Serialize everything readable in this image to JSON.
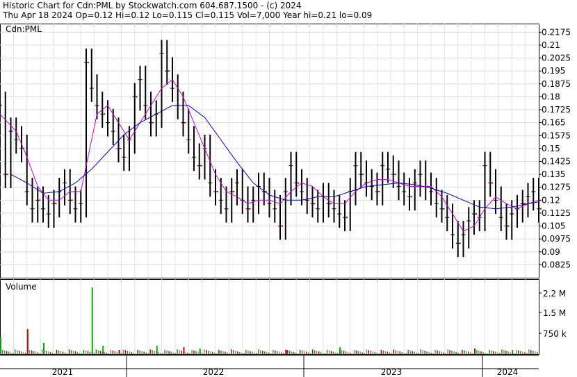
{
  "header": {
    "line1": "Historic Chart for Cdn:PML by Stockwatch.com 604.687.1500 - (c) 2024",
    "line2": "Thu Apr 18 2024  Op=0.12  Hi=0.12  Lo=0.115  Cl=0.115  Vol=7,000  Year hi=0.21  lo=0.09"
  },
  "chart_data": [
    {
      "type": "line",
      "title": "Cdn:PML",
      "y_ticks": [
        0.2175,
        0.21,
        0.2025,
        0.195,
        0.1875,
        0.18,
        0.1725,
        0.165,
        0.1575,
        0.15,
        0.1425,
        0.135,
        0.1275,
        0.12,
        0.1125,
        0.105,
        0.0975,
        0.09,
        0.0825
      ],
      "y_tick_labels": [
        "0.2175",
        "0.21",
        "0.2025",
        "0.195",
        "0.1875",
        "0.18",
        "0.1725",
        "0.165",
        "0.1575",
        "0.15",
        "0.1425",
        "0.135",
        "0.1275",
        "0.12",
        "0.1125",
        "0.105",
        "0.0975",
        "0.09",
        "0.0825"
      ],
      "ylim": [
        0.075,
        0.2225
      ],
      "x_labels": [
        "2021",
        "2022",
        "2023",
        "2024"
      ],
      "grid": true,
      "series_colors": {
        "price": "#000000",
        "short_ma": "#cc00cc",
        "long_ma": "#0000cc",
        "marks": "#dd0000"
      },
      "price_points": [
        [
          0.0,
          0.175
        ],
        [
          0.01,
          0.135
        ],
        [
          0.02,
          0.16
        ],
        [
          0.03,
          0.155
        ],
        [
          0.04,
          0.15
        ],
        [
          0.05,
          0.125
        ],
        [
          0.06,
          0.115
        ],
        [
          0.07,
          0.12
        ],
        [
          0.08,
          0.115
        ],
        [
          0.09,
          0.112
        ],
        [
          0.1,
          0.118
        ],
        [
          0.11,
          0.125
        ],
        [
          0.12,
          0.13
        ],
        [
          0.13,
          0.12
        ],
        [
          0.14,
          0.115
        ],
        [
          0.15,
          0.118
        ],
        [
          0.16,
          0.2
        ],
        [
          0.17,
          0.185
        ],
        [
          0.18,
          0.175
        ],
        [
          0.19,
          0.17
        ],
        [
          0.2,
          0.165
        ],
        [
          0.21,
          0.16
        ],
        [
          0.22,
          0.15
        ],
        [
          0.23,
          0.145
        ],
        [
          0.24,
          0.155
        ],
        [
          0.25,
          0.18
        ],
        [
          0.26,
          0.19
        ],
        [
          0.27,
          0.175
        ],
        [
          0.28,
          0.165
        ],
        [
          0.29,
          0.17
        ],
        [
          0.3,
          0.205
        ],
        [
          0.31,
          0.195
        ],
        [
          0.32,
          0.185
        ],
        [
          0.33,
          0.175
        ],
        [
          0.34,
          0.165
        ],
        [
          0.35,
          0.155
        ],
        [
          0.36,
          0.145
        ],
        [
          0.37,
          0.14
        ],
        [
          0.38,
          0.15
        ],
        [
          0.39,
          0.13
        ],
        [
          0.4,
          0.125
        ],
        [
          0.41,
          0.12
        ],
        [
          0.42,
          0.115
        ],
        [
          0.43,
          0.125
        ],
        [
          0.44,
          0.13
        ],
        [
          0.45,
          0.12
        ],
        [
          0.46,
          0.115
        ],
        [
          0.47,
          0.12
        ],
        [
          0.48,
          0.128
        ],
        [
          0.49,
          0.125
        ],
        [
          0.5,
          0.118
        ],
        [
          0.51,
          0.115
        ],
        [
          0.52,
          0.105
        ],
        [
          0.53,
          0.125
        ],
        [
          0.54,
          0.14
        ],
        [
          0.55,
          0.13
        ],
        [
          0.56,
          0.125
        ],
        [
          0.57,
          0.12
        ],
        [
          0.58,
          0.118
        ],
        [
          0.59,
          0.115
        ],
        [
          0.6,
          0.122
        ],
        [
          0.61,
          0.118
        ],
        [
          0.62,
          0.115
        ],
        [
          0.63,
          0.112
        ],
        [
          0.64,
          0.11
        ],
        [
          0.65,
          0.125
        ],
        [
          0.66,
          0.14
        ],
        [
          0.67,
          0.135
        ],
        [
          0.68,
          0.13
        ],
        [
          0.69,
          0.128
        ],
        [
          0.7,
          0.125
        ],
        [
          0.71,
          0.14
        ],
        [
          0.72,
          0.138
        ],
        [
          0.73,
          0.135
        ],
        [
          0.74,
          0.128
        ],
        [
          0.75,
          0.125
        ],
        [
          0.76,
          0.122
        ],
        [
          0.77,
          0.13
        ],
        [
          0.78,
          0.135
        ],
        [
          0.79,
          0.128
        ],
        [
          0.8,
          0.125
        ],
        [
          0.81,
          0.118
        ],
        [
          0.82,
          0.115
        ],
        [
          0.83,
          0.11
        ],
        [
          0.84,
          0.1
        ],
        [
          0.85,
          0.095
        ],
        [
          0.86,
          0.1
        ],
        [
          0.87,
          0.108
        ],
        [
          0.88,
          0.112
        ],
        [
          0.89,
          0.11
        ],
        [
          0.9,
          0.14
        ],
        [
          0.91,
          0.13
        ],
        [
          0.92,
          0.12
        ],
        [
          0.93,
          0.11
        ],
        [
          0.94,
          0.105
        ],
        [
          0.95,
          0.112
        ],
        [
          0.96,
          0.115
        ],
        [
          0.97,
          0.118
        ],
        [
          0.98,
          0.122
        ],
        [
          0.99,
          0.125
        ],
        [
          1.0,
          0.115
        ]
      ],
      "short_ma": [
        [
          0.0,
          0.17
        ],
        [
          0.03,
          0.16
        ],
        [
          0.05,
          0.145
        ],
        [
          0.07,
          0.128
        ],
        [
          0.09,
          0.12
        ],
        [
          0.11,
          0.12
        ],
        [
          0.13,
          0.125
        ],
        [
          0.15,
          0.125
        ],
        [
          0.16,
          0.14
        ],
        [
          0.18,
          0.17
        ],
        [
          0.2,
          0.175
        ],
        [
          0.22,
          0.165
        ],
        [
          0.24,
          0.155
        ],
        [
          0.26,
          0.165
        ],
        [
          0.28,
          0.175
        ],
        [
          0.3,
          0.185
        ],
        [
          0.32,
          0.19
        ],
        [
          0.34,
          0.18
        ],
        [
          0.36,
          0.165
        ],
        [
          0.38,
          0.15
        ],
        [
          0.4,
          0.135
        ],
        [
          0.42,
          0.125
        ],
        [
          0.44,
          0.122
        ],
        [
          0.46,
          0.118
        ],
        [
          0.48,
          0.12
        ],
        [
          0.5,
          0.12
        ],
        [
          0.52,
          0.118
        ],
        [
          0.54,
          0.125
        ],
        [
          0.56,
          0.13
        ],
        [
          0.58,
          0.128
        ],
        [
          0.6,
          0.122
        ],
        [
          0.62,
          0.118
        ],
        [
          0.64,
          0.118
        ],
        [
          0.66,
          0.125
        ],
        [
          0.68,
          0.13
        ],
        [
          0.7,
          0.132
        ],
        [
          0.72,
          0.132
        ],
        [
          0.74,
          0.13
        ],
        [
          0.76,
          0.128
        ],
        [
          0.78,
          0.128
        ],
        [
          0.8,
          0.128
        ],
        [
          0.82,
          0.122
        ],
        [
          0.84,
          0.112
        ],
        [
          0.86,
          0.102
        ],
        [
          0.88,
          0.105
        ],
        [
          0.9,
          0.115
        ],
        [
          0.92,
          0.122
        ],
        [
          0.94,
          0.118
        ],
        [
          0.96,
          0.115
        ],
        [
          0.98,
          0.118
        ],
        [
          1.0,
          0.12
        ]
      ],
      "long_ma": [
        [
          0.02,
          0.135
        ],
        [
          0.05,
          0.13
        ],
        [
          0.08,
          0.124
        ],
        [
          0.11,
          0.125
        ],
        [
          0.14,
          0.13
        ],
        [
          0.17,
          0.138
        ],
        [
          0.2,
          0.148
        ],
        [
          0.23,
          0.158
        ],
        [
          0.26,
          0.165
        ],
        [
          0.29,
          0.17
        ],
        [
          0.32,
          0.175
        ],
        [
          0.35,
          0.175
        ],
        [
          0.38,
          0.168
        ],
        [
          0.41,
          0.155
        ],
        [
          0.44,
          0.142
        ],
        [
          0.47,
          0.13
        ],
        [
          0.5,
          0.123
        ],
        [
          0.53,
          0.12
        ],
        [
          0.56,
          0.12
        ],
        [
          0.59,
          0.122
        ],
        [
          0.62,
          0.122
        ],
        [
          0.65,
          0.125
        ],
        [
          0.68,
          0.128
        ],
        [
          0.71,
          0.129
        ],
        [
          0.74,
          0.13
        ],
        [
          0.77,
          0.129
        ],
        [
          0.8,
          0.127
        ],
        [
          0.83,
          0.124
        ],
        [
          0.86,
          0.12
        ],
        [
          0.89,
          0.116
        ],
        [
          0.92,
          0.115
        ],
        [
          0.95,
          0.116
        ],
        [
          0.98,
          0.118
        ],
        [
          1.0,
          0.119
        ]
      ]
    },
    {
      "type": "bar",
      "title": "Volume",
      "y_tick_labels": [
        "2.2 M",
        "1.5 M",
        "750 k"
      ],
      "y_ticks": [
        2200000,
        1500000,
        750000
      ],
      "ylim": [
        0,
        2700000
      ],
      "spikes": [
        [
          0.0,
          600000
        ],
        [
          0.05,
          900000
        ],
        [
          0.08,
          400000
        ],
        [
          0.17,
          2400000
        ],
        [
          0.19,
          300000
        ],
        [
          0.22,
          150000
        ],
        [
          0.29,
          300000
        ],
        [
          0.34,
          250000
        ],
        [
          0.37,
          200000
        ],
        [
          0.53,
          150000
        ],
        [
          0.63,
          250000
        ],
        [
          0.88,
          200000
        ],
        [
          0.95,
          150000
        ]
      ]
    }
  ]
}
